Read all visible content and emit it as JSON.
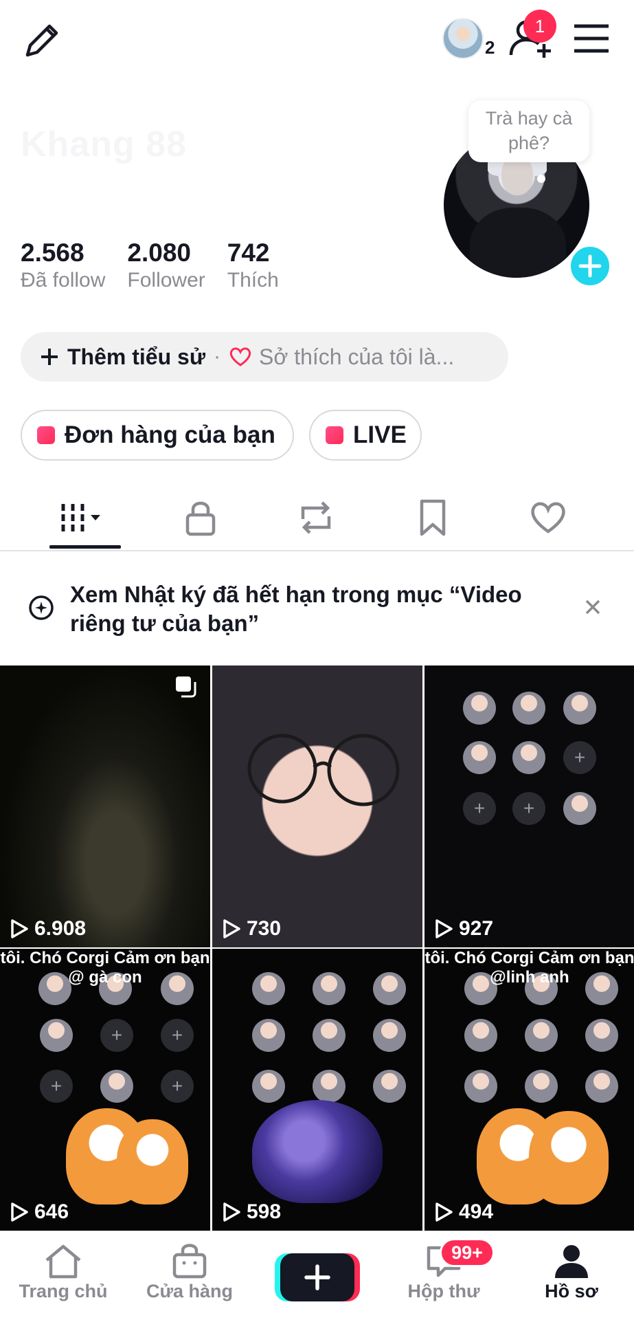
{
  "topbar": {
    "friends_count": "2",
    "notification_count": "1"
  },
  "profile": {
    "name": "Khang 88",
    "username": "",
    "avatar_bubble": "Trà hay cà phê?",
    "stats": [
      {
        "value": "2.568",
        "label": "Đã follow"
      },
      {
        "value": "2.080",
        "label": "Follower"
      },
      {
        "value": "742",
        "label": "Thích"
      }
    ],
    "bio_add_label": "Thêm tiểu sử",
    "bio_separator": "·",
    "bio_hint": "Sở thích của tôi là...",
    "chips": {
      "orders_label": "Đơn hàng của bạn",
      "live_label": "LIVE"
    }
  },
  "tabs": [
    {
      "icon": "grid-icon",
      "active": true
    },
    {
      "icon": "lock-icon"
    },
    {
      "icon": "repost-icon"
    },
    {
      "icon": "bookmark-icon"
    },
    {
      "icon": "heart-icon"
    }
  ],
  "notice": {
    "text": "Xem Nhật ký đã hết hạn trong mục “Video riêng tư của bạn”"
  },
  "videos": [
    {
      "views": "6.908",
      "caption": ""
    },
    {
      "views": "730",
      "caption": ""
    },
    {
      "views": "927",
      "caption": ""
    },
    {
      "views": "646",
      "caption": "tôi. Chó Corgi Cảm ơn bạn @ gà con"
    },
    {
      "views": "598",
      "caption": ""
    },
    {
      "views": "494",
      "caption": "tôi. Chó Corgi Cảm ơn bạn @linh anh"
    }
  ],
  "bottom_nav": {
    "home": "Trang chủ",
    "shop": "Cửa hàng",
    "inbox": "Hộp thư",
    "inbox_badge": "99+",
    "profile": "Hồ sơ"
  },
  "colors": {
    "accent_red": "#fe2c55",
    "accent_cyan": "#20d5ec",
    "text_primary": "#161823",
    "text_secondary": "#8a8b91"
  }
}
